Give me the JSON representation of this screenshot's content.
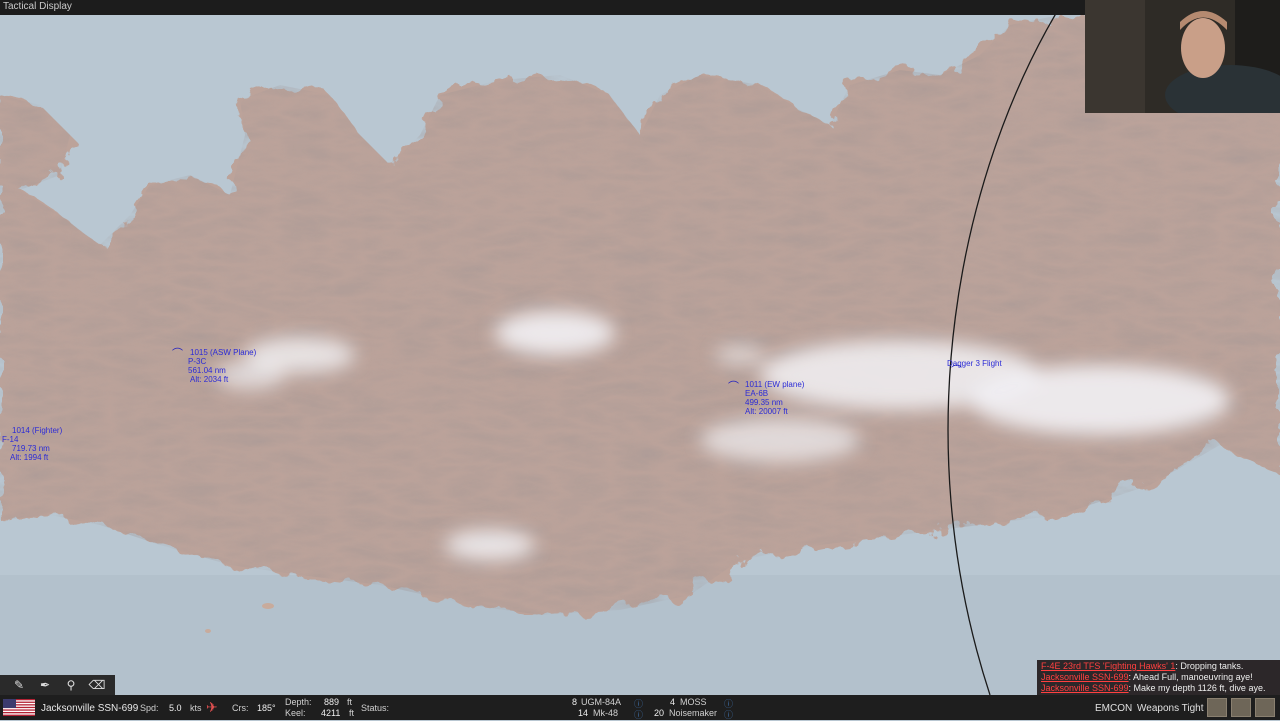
{
  "window": {
    "title": "Tactical Display"
  },
  "map": {
    "units": [
      {
        "id": "1015",
        "name": "1015 (ASW Plane)",
        "type": "P-3C",
        "range": "561.04 nm",
        "alt": "Alt: 2034 ft"
      },
      {
        "id": "1014",
        "name": "1014 (Fighter)",
        "type": "F-14",
        "range": "719.73 nm",
        "alt": "Alt: 1994 ft"
      },
      {
        "id": "1011",
        "name": "1011 (EW plane)",
        "type": "EA-6B",
        "range": "499.35 nm",
        "alt": "Alt: 20007 ft"
      },
      {
        "id": "dagger3",
        "name": "Dagger 3 Flight"
      }
    ]
  },
  "chat": [
    {
      "who": "F-4E 23rd TFS 'Fighting Hawks' 1",
      "msg": ": Dropping tanks."
    },
    {
      "who": "Jacksonville SSN-699",
      "msg": ": Ahead Full, manoeuvring aye!"
    },
    {
      "who": "Jacksonville SSN-699",
      "msg": ": Make my depth 1126 ft, dive aye."
    }
  ],
  "status": {
    "unit_name": "Jacksonville SSN-699",
    "spd_label": "Spd:",
    "spd_value": "5.0",
    "spd_unit": "kts",
    "crs_label": "Crs:",
    "crs_value": "185°",
    "depth_label": "Depth:",
    "depth_value": "889",
    "depth_unit": "ft",
    "keel_label": "Keel:",
    "keel_value": "4211",
    "keel_unit": "ft",
    "status_label": "Status:",
    "weapons": [
      {
        "count": "8",
        "name": "UGM-84A"
      },
      {
        "count": "14",
        "name": "Mk-48"
      },
      {
        "count": "4",
        "name": "MOSS"
      },
      {
        "count": "20",
        "name": "Noisemaker"
      }
    ],
    "emcon": "EMCON",
    "weapons_state": "Weapons Tight"
  },
  "colors": {
    "unit": "#2b2bd6",
    "chat_name": "#ff4040",
    "sea": "#b9c7d2",
    "land": "#bda59b"
  },
  "icons": {
    "flag": "us-flag-icon",
    "tools": [
      "pencil-icon",
      "pen-icon",
      "pin-icon",
      "eraser-icon"
    ]
  }
}
